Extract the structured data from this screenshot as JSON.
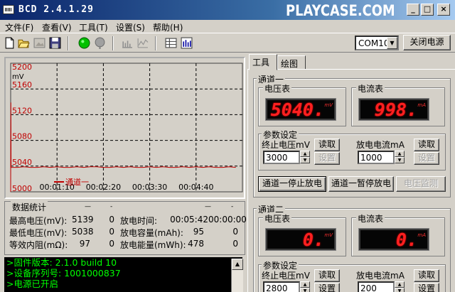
{
  "window": {
    "title": "BCD  2.4.1.29",
    "watermark": "PLAYCASE.COM",
    "min_glyph": "_",
    "max_glyph": "□",
    "close_glyph": "×"
  },
  "menu": [
    {
      "label": "文件(F)"
    },
    {
      "label": "查看(V)"
    },
    {
      "label": "工具(T)"
    },
    {
      "label": "设置(S)"
    },
    {
      "label": "帮助(H)"
    }
  ],
  "toolbar": {
    "com_port": "COM10",
    "power_button": "关闭电源",
    "icons": [
      "new-file-icon",
      "open-folder-icon",
      "disabled-image-icon",
      "save-icon",
      "green-run-icon",
      "gray-stop-icon",
      "chart-bars-icon",
      "chart-wave-icon",
      "table-icon",
      "bar-chart-icon"
    ]
  },
  "chart_data": {
    "type": "line",
    "ylabel": "mV",
    "ylim": [
      5000,
      5200
    ],
    "y_ticks": [
      "5200",
      "5160",
      "5120",
      "5080",
      "5040",
      "5000"
    ],
    "x_ticks": [
      "00:01:10",
      "00:02:20",
      "00:03:30",
      "00:04:40"
    ],
    "grid": true,
    "series": [
      {
        "name": "通道一",
        "color": "#c00000",
        "x": [
          0,
          0.3,
          0.6,
          10,
          20,
          30,
          40,
          50,
          60,
          70,
          80,
          90,
          100,
          110,
          120,
          130,
          140,
          150,
          160,
          170,
          180,
          190,
          200,
          210,
          220,
          230,
          240,
          250,
          260,
          270,
          280,
          290,
          300,
          310,
          320,
          330,
          340
        ],
        "values": [
          5000,
          5139,
          5038,
          5038,
          5039,
          5038,
          5038,
          5039,
          5038,
          5039,
          5038,
          5038,
          5039,
          5038,
          5039,
          5039,
          5038,
          5038,
          5039,
          5038,
          5039,
          5038,
          5038,
          5039,
          5038,
          5039,
          5038,
          5038,
          5039,
          5038,
          5039,
          5038,
          5039,
          5038,
          5038,
          5039,
          5038
        ]
      }
    ]
  },
  "stats": {
    "legend": "数据统计",
    "col_marks": [
      "—",
      "-",
      "—",
      "-"
    ],
    "rows": [
      {
        "label": "最高电压(mV):",
        "v1": "5139",
        "v2": "0",
        "label2": "放电时间:",
        "v3": "00:05:42",
        "v4": "00:00:00"
      },
      {
        "label": "最低电压(mV):",
        "v1": "5038",
        "v2": "0",
        "label2": "放电容量(mAh):",
        "v3": "95",
        "v4": "0"
      },
      {
        "label": "等效内阻(mΩ):",
        "v1": "97",
        "v2": "0",
        "label2": "放电能量(mWh):",
        "v3": "478",
        "v4": "0"
      }
    ]
  },
  "console": {
    "lines": [
      ">固件版本: 2.1.0 build 10",
      ">设备序列号: 1001000837",
      ">电源已开启"
    ],
    "scroll_up": "▲"
  },
  "tabs": [
    {
      "label": "工具"
    },
    {
      "label": "绘图"
    }
  ],
  "channel1": {
    "title": "通道一",
    "voltmeter_label": "电压表",
    "voltmeter_value": "5040.",
    "voltmeter_unit": "mV",
    "ammeter_label": "电流表",
    "ammeter_value": "998.",
    "ammeter_unit": "mA",
    "params_label": "参数设定",
    "cutoff_label": "终止电压mV",
    "cutoff_value": "3000",
    "current_label": "放电电流mA",
    "current_value": "1000",
    "read_label": "读取",
    "set_label": "设置",
    "stop_button": "通道一停止放电",
    "pause_button": "通道一暂停放电",
    "monitor_button": "电压监测"
  },
  "channel2": {
    "title": "通道二",
    "voltmeter_label": "电压表",
    "voltmeter_value": "0.",
    "voltmeter_unit": "mV",
    "ammeter_label": "电流表",
    "ammeter_value": "0.",
    "ammeter_unit": "mA",
    "params_label": "参数设定",
    "cutoff_label": "终止电压mV",
    "cutoff_value": "2800",
    "current_label": "放电电流mA",
    "current_value": "200",
    "read_label": "读取",
    "set_label": "设置"
  }
}
